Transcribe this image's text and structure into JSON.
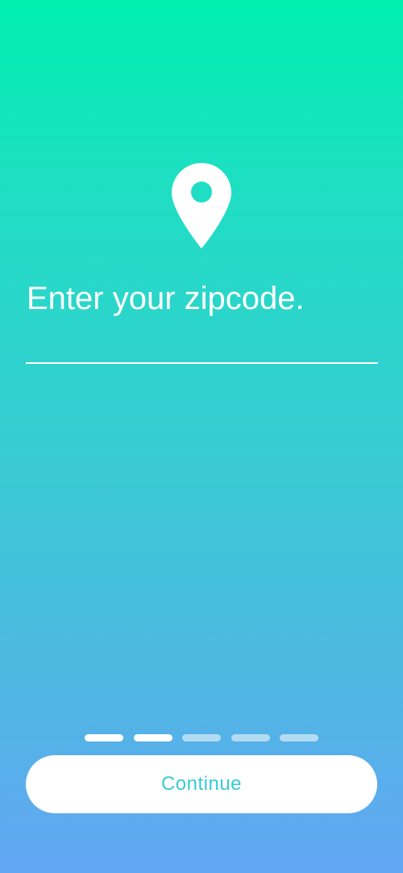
{
  "icons": {
    "location": "location-pin-icon"
  },
  "colors": {
    "gradient_top": "#00F0B0",
    "gradient_bottom": "#63A6F4",
    "button_text": "#37CBD5",
    "foreground": "#FFFFFF"
  },
  "prompt": {
    "title": "Enter your zipcode."
  },
  "zipcode": {
    "value": "",
    "placeholder": ""
  },
  "progress": {
    "total_steps": 5,
    "completed_steps": 2
  },
  "actions": {
    "continue_label": "Continue"
  }
}
